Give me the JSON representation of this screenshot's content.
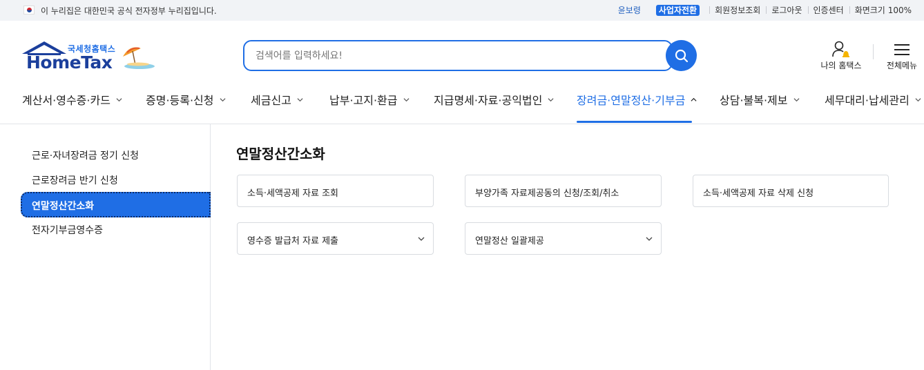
{
  "gov_banner": {
    "text": "이 누리집은 대한민국 공식 전자정부 누리집입니다."
  },
  "util": {
    "user_name": "윤보령",
    "switch_label": "사업자전환",
    "member_info": "회원정보조회",
    "logout": "로그아웃",
    "cert_center": "인증센터",
    "zoom_label": "화면크기",
    "zoom_value": "100%"
  },
  "logo": {
    "sub": "국세청홈택스",
    "main": "HomeTax"
  },
  "search": {
    "placeholder": "검색어를 입력하세요!"
  },
  "header_actions": {
    "my_hometax": "나의 홈택스",
    "all_menu": "전체메뉴"
  },
  "gnb": [
    "계산서·영수증·카드",
    "증명·등록·신청",
    "세금신고",
    "납부·고지·환급",
    "지급명세·자료·공익법인",
    "장려금·연말정산·기부금",
    "상담·불복·제보",
    "세무대리·납세관리"
  ],
  "gnb_active_index": 5,
  "side_nav": [
    "근로·자녀장려금 정기 신청",
    "근로장려금 반기 신청",
    "연말정산간소화",
    "전자기부금영수증"
  ],
  "side_active_index": 2,
  "main": {
    "title": "연말정산간소화",
    "cards": [
      {
        "label": "소득·세액공제 자료 조회",
        "expandable": false
      },
      {
        "label": "부양가족 자료제공동의 신청/조회/취소",
        "expandable": false
      },
      {
        "label": "소득·세액공제 자료 삭제 신청",
        "expandable": false
      },
      {
        "label": "영수증 발급처 자료 제출",
        "expandable": true
      },
      {
        "label": "연말정산 일괄제공",
        "expandable": true
      }
    ]
  },
  "colors": {
    "accent": "#1f6ee5",
    "brand_dark": "#1b3f9c"
  }
}
